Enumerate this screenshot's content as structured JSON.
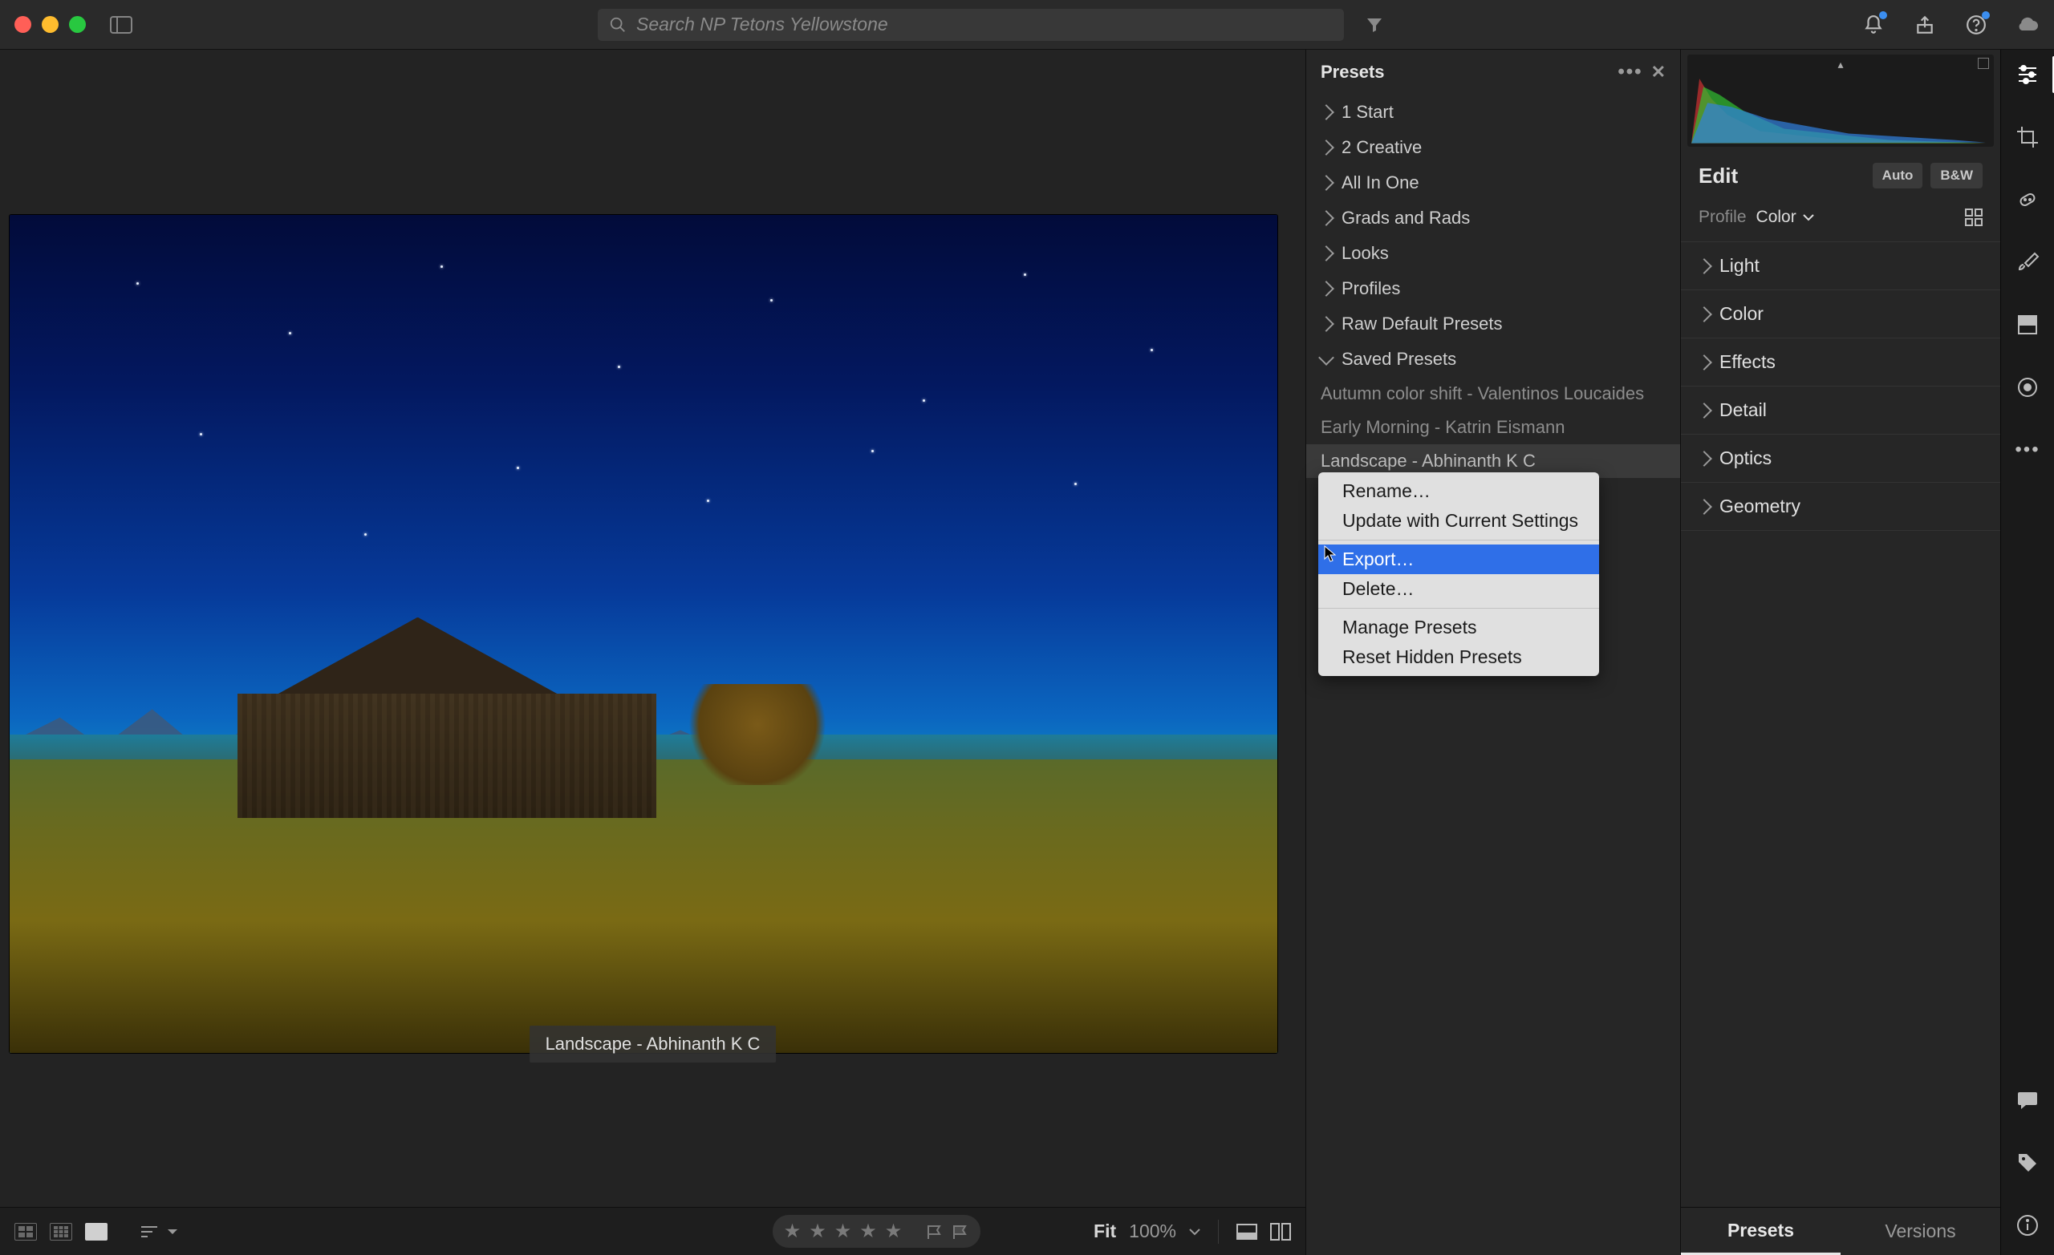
{
  "titlebar": {
    "search_placeholder": "Search NP Tetons Yellowstone"
  },
  "presets": {
    "title": "Presets",
    "groups": [
      "1 Start",
      "2 Creative",
      "All In One",
      "Grads and Rads",
      "Looks",
      "Profiles",
      "Raw Default Presets"
    ],
    "saved_label": "Saved Presets",
    "saved_items": [
      "Autumn color shift - Valentinos Loucaides",
      "Early Morning - Katrin Eismann",
      "Landscape - Abhinanth K C"
    ],
    "selected_index": 2
  },
  "context_menu": {
    "rename": "Rename…",
    "update": "Update with Current Settings",
    "export": "Export…",
    "delete": "Delete…",
    "manage": "Manage Presets",
    "reset": "Reset Hidden Presets"
  },
  "caption": "Landscape - Abhinanth K C",
  "edit": {
    "title": "Edit",
    "auto": "Auto",
    "bw": "B&W",
    "profile_label": "Profile",
    "profile_value": "Color",
    "sections": [
      "Light",
      "Color",
      "Effects",
      "Detail",
      "Optics",
      "Geometry"
    ]
  },
  "bottom": {
    "fit": "Fit",
    "zoom": "100%"
  },
  "right_tabs": {
    "presets": "Presets",
    "versions": "Versions"
  }
}
